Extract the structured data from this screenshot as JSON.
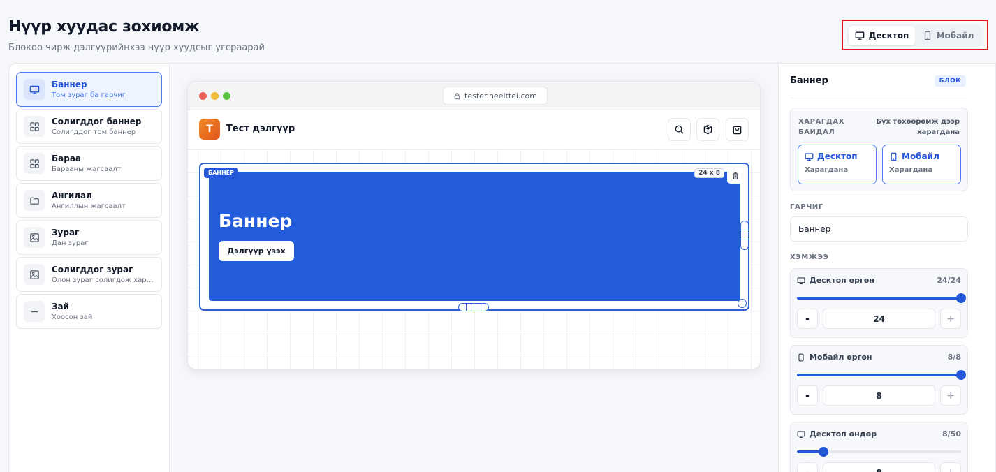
{
  "header": {
    "title": "Нүүр хуудас зохиомж",
    "subtitle": "Блокоо чирж дэлгүүрийнхээ нүүр хуудсыг угсраарай"
  },
  "mode_toggle": {
    "desktop_label": "Десктоп",
    "mobile_label": "Мобайл",
    "active": "desktop"
  },
  "blocks": [
    {
      "title": "Баннер",
      "desc": "Том зураг ба гарчиг",
      "icon": "monitor-icon",
      "active": true
    },
    {
      "title": "Солигддог баннер",
      "desc": "Солигддог том баннер",
      "icon": "grid-icon"
    },
    {
      "title": "Бараа",
      "desc": "Барааны жагсаалт",
      "icon": "grid-icon"
    },
    {
      "title": "Ангилал",
      "desc": "Ангиллын жагсаалт",
      "icon": "folder-icon"
    },
    {
      "title": "Зураг",
      "desc": "Дан зураг",
      "icon": "image-icon"
    },
    {
      "title": "Солигддог зураг",
      "desc": "Олон зураг солигдож харагдана",
      "icon": "image-icon"
    },
    {
      "title": "Зай",
      "desc": "Хоосон зай",
      "icon": "minus-icon"
    }
  ],
  "preview": {
    "url": "tester.neelttei.com",
    "store_logo_letter": "T",
    "store_name": "Тест дэлгүүр",
    "banner": {
      "tag": "БАННЕР",
      "size": "24 x 8",
      "heading": "Баннер",
      "button": "Дэлгүүр үзэх"
    }
  },
  "properties": {
    "title": "Баннер",
    "badge": "БЛОК",
    "visibility": {
      "label": "ХАРАГДАХ БАЙДАЛ",
      "note": "Бүх төхөөрөмж дээр харагдана",
      "options": [
        {
          "label": "Десктоп",
          "sub": "Харагдана",
          "icon": "monitor-icon"
        },
        {
          "label": "Мобайл",
          "sub": "Харагдана",
          "icon": "phone-icon"
        }
      ]
    },
    "title_section_label": "ГАРЧИГ",
    "title_value": "Баннер",
    "size_section_label": "ХЭМЖЭЭ",
    "sizes": [
      {
        "label": "Десктоп өргөн",
        "value_text": "24/24",
        "value": "24",
        "fraction": 1.0,
        "icon": "monitor-icon"
      },
      {
        "label": "Мобайл өргөн",
        "value_text": "8/8",
        "value": "8",
        "fraction": 1.0,
        "icon": "phone-icon"
      },
      {
        "label": "Десктоп өндөр",
        "value_text": "8/50",
        "value": "8",
        "fraction": 0.16,
        "icon": "monitor-icon"
      }
    ],
    "minus_label": "-",
    "plus_label": "+"
  },
  "colors": {
    "accent": "#2456d8",
    "banner_bg": "#235ddc",
    "highlight_frame": "#e01a22"
  }
}
